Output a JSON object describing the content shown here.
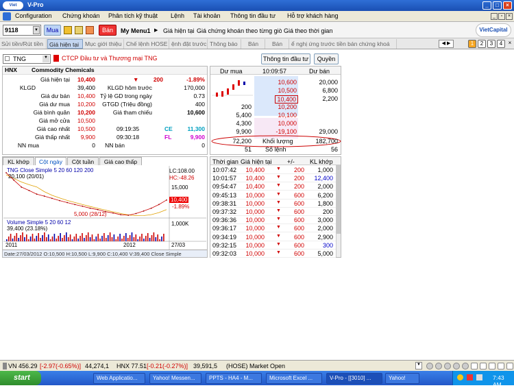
{
  "window": {
    "title": "V-Pro",
    "logo_text": "VietCapital"
  },
  "menu": [
    "Configuration",
    "Chứng khoán",
    "Phân tích kỹ thuật",
    "Lệnh",
    "Tài khoản",
    "Thông tin đầu tư",
    "Hỗ trợ khách hàng"
  ],
  "toolbar": {
    "account": "9118",
    "buy_label": "Mua",
    "sell_label": "Bán",
    "my_menu": "My Menu1",
    "links": [
      "Giá hiện tại",
      "Giá chứng khoán theo từng giờ",
      "Giá theo thời gian"
    ],
    "brand": "VietCapital"
  },
  "tabs": [
    "Sửi tiền/Rút tiền",
    "Giá hiện tại",
    "Mục giới thiệu",
    "Chế lệnh HOSE",
    "ệnh đặt trước",
    "Thông báo",
    "Bán",
    "Bán",
    "ể nghị ứng trước tiền bán chứng khoá"
  ],
  "pages": [
    "1",
    "2",
    "3",
    "4"
  ],
  "symbol": {
    "code": "TNG",
    "name": "CTCP Đầu tư và Thương mại TNG",
    "btn_info": "Thông tin đầu tư",
    "btn_right": "Quyền"
  },
  "info": {
    "exchange": "HNX",
    "sector": "Commodity Chemicals",
    "rows": [
      {
        "l1": "Giá hiện tại",
        "v1": "10,400",
        "l2": "▼",
        "v2": "200",
        "v3": "-1.89%"
      },
      {
        "l1": "KLGD",
        "v1": "39,400",
        "l2": "KLGD hôm trước",
        "v2": "170,000"
      },
      {
        "l1": "Giá dư bán",
        "v1": "10,400",
        "l2": "Tỷ lệ GD trong ngày",
        "v2": "0.73"
      },
      {
        "l1": "Giá dư mua",
        "v1": "10,200",
        "l2": "GTGD (Triệu đồng)",
        "v2": "400"
      },
      {
        "l1": "Giá bình quân",
        "v1": "10,200",
        "l2": "Giá tham chiếu",
        "v2": "10,600"
      },
      {
        "l1": "Giá mở cửa",
        "v1": "10,500"
      },
      {
        "l1": "Giá cao nhất",
        "v1": "10,500",
        "t": "09:19:35",
        "tag": "CE",
        "v2": "11,300"
      },
      {
        "l1": "Giá thấp nhất",
        "v1": "9,900",
        "t": "09:30:18",
        "tag": "FL",
        "v2": "9,900"
      },
      {
        "l1": "NN mua",
        "v1": "0",
        "l2": "NN bán",
        "v2": "0"
      }
    ]
  },
  "orderbook": {
    "h_buy": "Dư mua",
    "time": "10:09:57",
    "h_sell": "Dư bán",
    "rows": [
      {
        "b": "",
        "p": "10,600",
        "s": "20,000"
      },
      {
        "b": "",
        "p": "10,500",
        "s": "6,800"
      },
      {
        "b": "",
        "p": "10,400",
        "s": "2,200"
      },
      {
        "b": "200",
        "p": "10,200",
        "s": ""
      },
      {
        "b": "5,400",
        "p": "10,100",
        "s": ""
      },
      {
        "b": "4,300",
        "p": "10,000",
        "s": ""
      },
      {
        "b": "9,900",
        "p": "-19,100",
        "s": "29,000"
      }
    ],
    "vol_b": "72,200",
    "vol_label": "Khối lượng",
    "vol_s": "182,700",
    "cnt_b": "51",
    "cnt_label": "Số lệnh",
    "cnt_s": "56"
  },
  "chart": {
    "tabs": [
      "KL khớp",
      "Cột ngày",
      "Cột tuần",
      "Giá cao thấp"
    ],
    "legend": "TNG  Close Simple 5  20  60  120  200",
    "hi_label": "20,100 (20/01)",
    "lo_label": "5,000 (28/12)",
    "lc": "LC:108.00",
    "hc": "HC:-48.26",
    "y_top": "15,000",
    "price": "10,400",
    "pct": "-1.89%",
    "y_mid": "5,000",
    "vol_legend": "Volume  Simple 5  20  60  12",
    "vol_val": "39,400 (23.18%)",
    "vol_axis": "1,000K",
    "x1": "2011",
    "x2": "2012",
    "date": "27/03",
    "footer": "Date:27/03/2012  O:10,500  H:10,500  L:9,900  C:10,400  V:39,400  Close Simple"
  },
  "chart_data": {
    "type": "line",
    "title": "TNG",
    "x": [
      "2011",
      "2012"
    ],
    "series": [
      {
        "name": "Close",
        "values": [
          20100,
          17500,
          15000,
          13800,
          12500,
          11800,
          11000,
          10200,
          9500,
          8800,
          8200,
          7500,
          7000,
          6300,
          5800,
          5200,
          5000,
          5600,
          6500,
          7500,
          8800,
          10400
        ]
      }
    ],
    "ylim": [
      5000,
      20100
    ]
  },
  "trades": {
    "headers": [
      "Thời gian",
      "Giá hiện tại",
      "+/-",
      "KL khớp"
    ],
    "rows": [
      [
        "10:07:42",
        "10,400",
        "200",
        "1,000"
      ],
      [
        "10:01:57",
        "10,400",
        "200",
        "12,400"
      ],
      [
        "09:54:47",
        "10,400",
        "200",
        "2,000"
      ],
      [
        "09:45:13",
        "10,000",
        "600",
        "6,200"
      ],
      [
        "09:38:31",
        "10,000",
        "600",
        "1,800"
      ],
      [
        "09:37:32",
        "10,000",
        "600",
        "200"
      ],
      [
        "09:36:36",
        "10,000",
        "600",
        "3,000"
      ],
      [
        "09:36:17",
        "10,000",
        "600",
        "2,000"
      ],
      [
        "09:34:19",
        "10,000",
        "600",
        "2,900"
      ],
      [
        "09:32:15",
        "10,000",
        "600",
        "300"
      ],
      [
        "09:32:03",
        "10,000",
        "600",
        "5,000"
      ]
    ]
  },
  "status": {
    "vn": "VN 456.29",
    "vn_chg": "[-2.97(-0.65%)]",
    "vn_vol": "44,274,1",
    "hnx": "HNX 77.51",
    "hnx_chg": "[-0.21(-0.27%)]",
    "hnx_vol": "39,591,5",
    "market": "(HOSE) Market Open"
  },
  "taskbar": {
    "start": "start",
    "tasks": [
      "Web Applicatio...",
      "Yahoo! Messen...",
      "PPTS - HA4 - M...",
      "Microsoft Excel ...",
      "V-Pro - [[3010] ...",
      "Yahoo!"
    ],
    "clock": "7:43 AM"
  }
}
